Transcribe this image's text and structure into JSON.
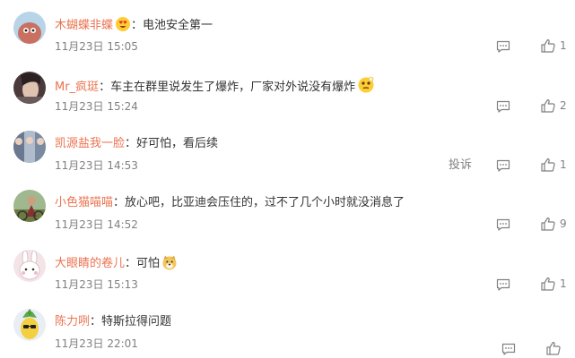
{
  "comments": [
    {
      "username": "木蝴蝶非蝶",
      "separator": "：",
      "text": "电池安全第一",
      "time": "11月23日 15:05",
      "likes": "1",
      "emoji": "heart-eyes-emoji",
      "avatar_color": "#c97060"
    },
    {
      "username": "Mr_疯珽",
      "separator": "：",
      "text": "车主在群里说发生了爆炸，厂家对外说没有爆炸",
      "time": "11月23日 15:24",
      "likes": "2",
      "emoji": "thinking-emoji",
      "avatar_color": "#5a4a48"
    },
    {
      "username": "凯源盐我一脸",
      "separator": "：",
      "text": "好可怕，看后续",
      "time": "11月23日 14:53",
      "likes": "1",
      "report_label": "投诉",
      "avatar_color": "#7a8aa0"
    },
    {
      "username": "小色猫喵喵",
      "separator": "：",
      "text": "放心吧，比亚迪会压住的，过不了几个小时就没消息了",
      "time": "11月23日 14:52",
      "likes": "9",
      "avatar_color": "#8a7050"
    },
    {
      "username": "大眼睛的卷儿",
      "separator": "：",
      "text": "可怕",
      "time": "11月23日 15:13",
      "likes": "1",
      "emoji": "doge-emoji",
      "avatar_color": "#f0d8dc"
    },
    {
      "username": "陈力咧",
      "separator": "：",
      "text": "特斯拉得问题",
      "time": "11月23日 22:01",
      "likes": "",
      "avatar_color": "#dfe8f0"
    }
  ],
  "colors": {
    "username": "#eb7350",
    "text": "#333333",
    "meta": "#808080",
    "background": "#ffffff"
  },
  "icons": {
    "reply": "comment-bubble-icon",
    "like": "thumbs-up-icon"
  }
}
